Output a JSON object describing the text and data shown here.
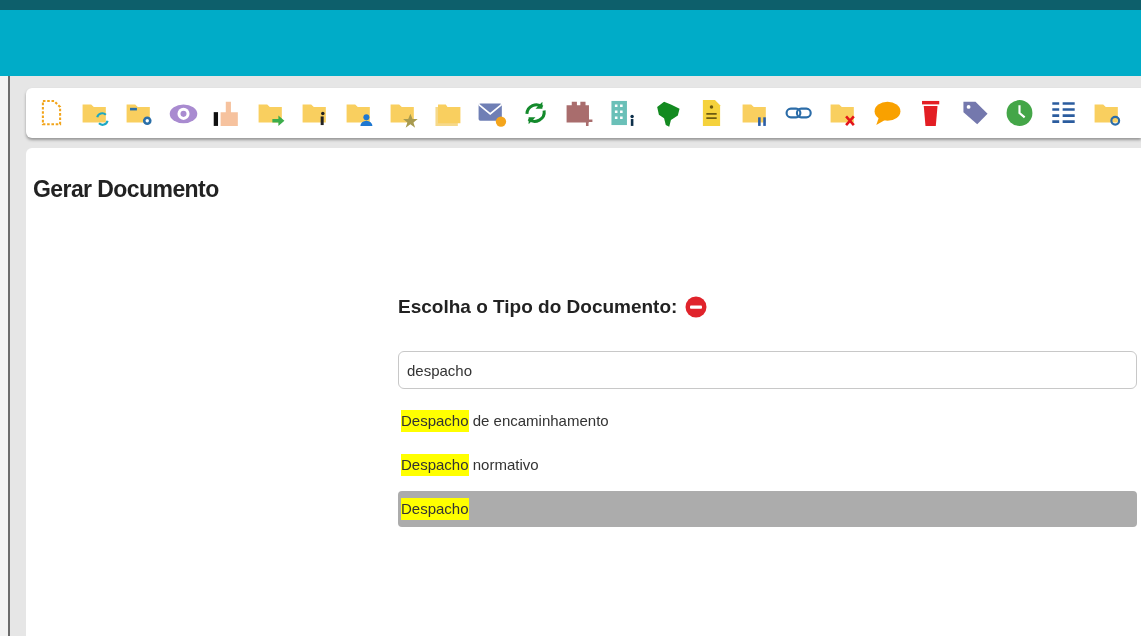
{
  "page_title": "Gerar Documento",
  "chooser": {
    "heading": "Escolha o Tipo do Documento:",
    "search": {
      "value": "despacho"
    },
    "options": [
      {
        "match": "Despacho",
        "rest": " de encaminhamento",
        "selected": false
      },
      {
        "match": "Despacho",
        "rest": " normativo",
        "selected": false
      },
      {
        "match": "Despacho",
        "selected": true
      }
    ]
  }
}
